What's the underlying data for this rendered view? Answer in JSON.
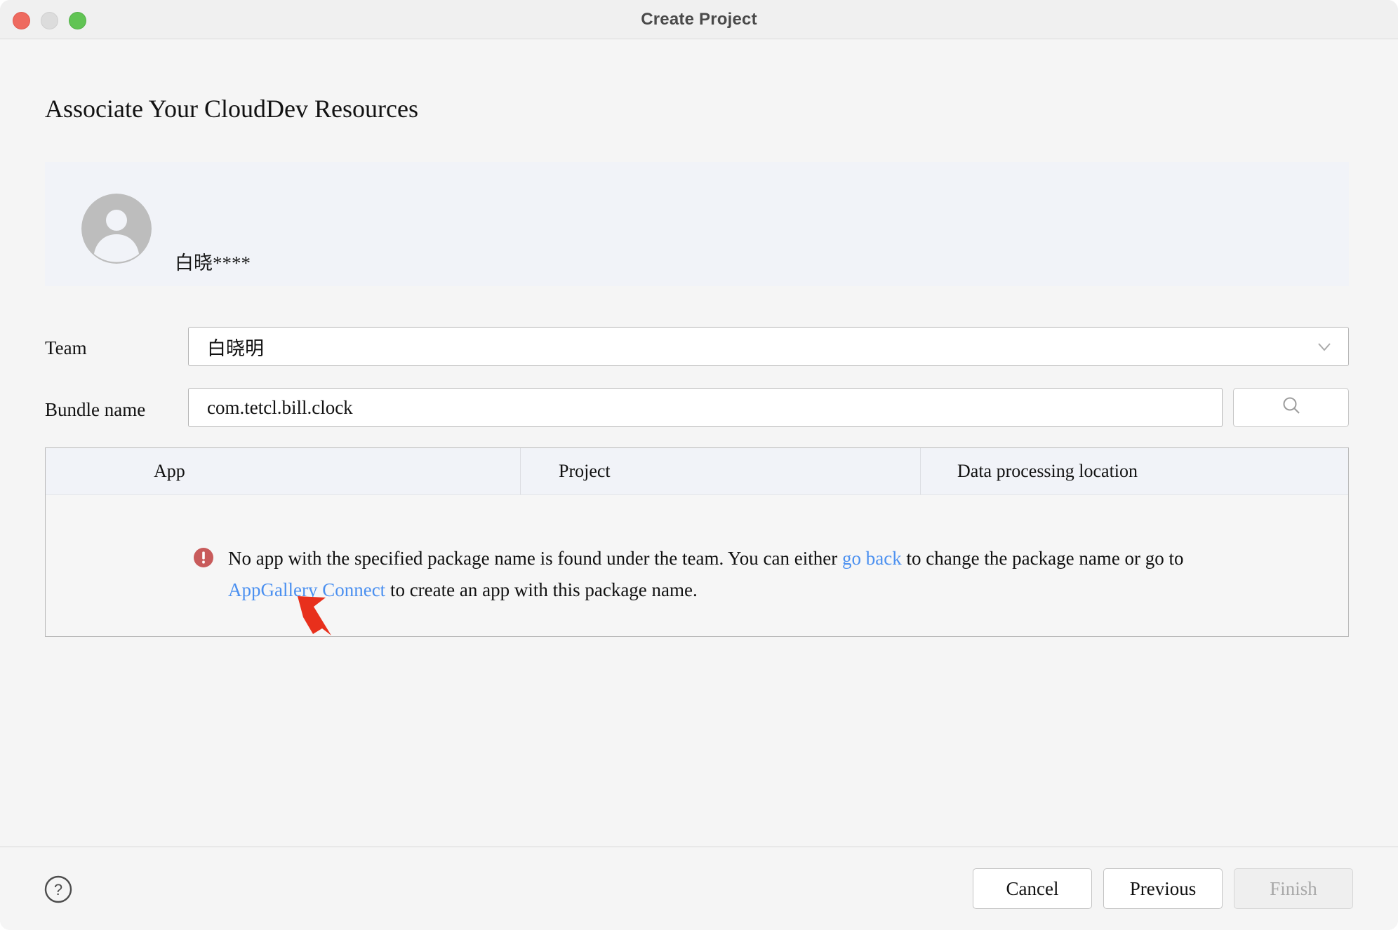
{
  "window": {
    "title": "Create Project",
    "traffic_lights": [
      "close",
      "minimize",
      "zoom"
    ]
  },
  "page": {
    "heading": "Associate Your CloudDev Resources"
  },
  "account": {
    "name": "白晓****",
    "avatar_icon": "person-avatar-icon"
  },
  "form": {
    "team": {
      "label": "Team",
      "value": "白晓明",
      "dropdown_icon": "chevron-down-icon"
    },
    "bundle": {
      "label": "Bundle name",
      "value": "com.tetcl.bill.clock",
      "placeholder": "Bundle name"
    },
    "search_button": {
      "icon": "search-icon",
      "label": ""
    }
  },
  "table": {
    "columns": [
      "App",
      "Project",
      "Data processing location"
    ],
    "rows": [],
    "empty_state": {
      "icon": "error-circle-icon",
      "text_part_1": "No app with the specified package name is found under the team. You can either ",
      "link_1": "go back",
      "text_part_2": " to change the package name or go to ",
      "link_2": "AppGallery Connect",
      "text_part_3": " to create an app with this package name."
    }
  },
  "annotation": {
    "cursor_icon": "red-arrow-cursor",
    "color": "#e8301c"
  },
  "footer": {
    "help_icon": "question-mark-circle-icon",
    "cancel_label": "Cancel",
    "previous_label": "Previous",
    "finish_label": "Finish",
    "finish_disabled": true
  },
  "colors": {
    "accent_link": "#4b90f0",
    "error": "#c85b5b",
    "panel_bg": "#f1f3f8",
    "window_bg": "#f5f5f5"
  }
}
